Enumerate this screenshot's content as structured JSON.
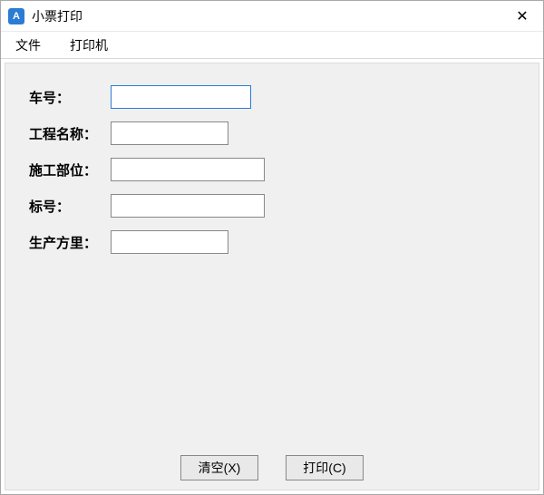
{
  "titlebar": {
    "icon_letter": "A",
    "title": "小票打印",
    "close_glyph": "✕"
  },
  "menu": {
    "file": "文件",
    "printer": "打印机"
  },
  "form": {
    "vehicle_no": {
      "label": "车号：",
      "value": ""
    },
    "project_name": {
      "label": "工程名称：",
      "value": ""
    },
    "construction_part": {
      "label": "施工部位：",
      "value": ""
    },
    "grade": {
      "label": "标号：",
      "value": ""
    },
    "production_volume": {
      "label": "生产方里：",
      "value": ""
    }
  },
  "buttons": {
    "clear": "清空(X)",
    "print": "打印(C)"
  }
}
